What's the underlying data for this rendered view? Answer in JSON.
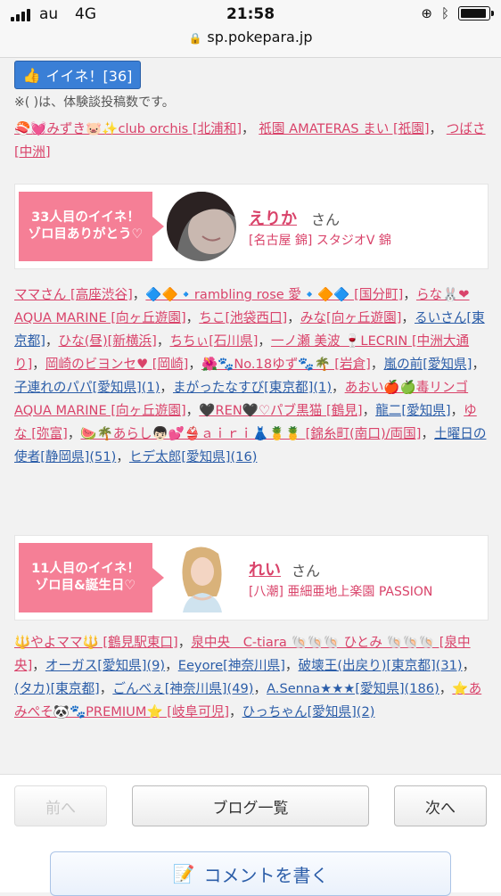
{
  "status_bar": {
    "carrier": "au",
    "network": "4G",
    "time": "21:58",
    "battery_level": 0.95
  },
  "browser": {
    "url": "sp.pokepara.jp"
  },
  "like_button": {
    "label": "イイネ！[36]"
  },
  "note": "※( )は、体験談投稿数です。",
  "section1": {
    "line1": "🍣💓みずき🐷✨club orchis [北浦和]",
    "comma": "，",
    "line2": "祇園 AMATERAS まい [祇園]",
    "line3": "つばさ[中洲]"
  },
  "card1": {
    "ribbon": "33人目のイイネ！\nゾロ目ありがとう♡",
    "name": "えりか",
    "san": "さん",
    "shop": "[名古屋 錦] スタジオV 錦"
  },
  "section2": {
    "items": [
      {
        "text": "ママさん [高座渋谷]",
        "c": "p"
      },
      {
        "text": "🔷🔶🔹rambling rose 愛🔹🔶🔷 [国分町]",
        "c": "p"
      },
      {
        "text": "らな🐰❤ AQUA MARINE [向ヶ丘遊園]",
        "c": "p"
      },
      {
        "text": "ちこ[池袋西口]",
        "c": "p"
      },
      {
        "text": "みな[向ヶ丘遊園]",
        "c": "p"
      },
      {
        "text": "るいさん[東京都]",
        "c": "b"
      },
      {
        "text": "ひな(昼)[新横浜]",
        "c": "p"
      },
      {
        "text": "ちちぃ[石川県]",
        "c": "p"
      },
      {
        "text": "一ノ瀬 美波 🍷LECRIN [中洲大通り]",
        "c": "p"
      },
      {
        "text": "岡崎のビヨンセ♥ [岡崎]",
        "c": "p"
      },
      {
        "text": "🌺🐾No.18ゆず🐾🌴 [岩倉]",
        "c": "p"
      },
      {
        "text": "嵐の前[愛知県]",
        "c": "b"
      },
      {
        "text": "子連れのパパ[愛知県](1)",
        "c": "b"
      },
      {
        "text": "まがったなすび[東京都](1)",
        "c": "b"
      },
      {
        "text": "あおい🍎🍏毒リンゴ AQUA MARINE [向ヶ丘遊園]",
        "c": "p"
      },
      {
        "text": "🖤REN🖤♡パブ黒猫 [鶴見]",
        "c": "p"
      },
      {
        "text": "龍二[愛知県]",
        "c": "b"
      },
      {
        "text": "ゆな [弥富]",
        "c": "p"
      },
      {
        "text": "🍉🌴あらし👦🏻💕👙ａｉｒｉ👗🍍🍍 [錦糸町(南口)/両国]",
        "c": "p"
      },
      {
        "text": "土曜日の使者[静岡県](51)",
        "c": "b"
      },
      {
        "text": "ヒデ太郎[愛知県](16)",
        "c": "b"
      }
    ]
  },
  "card2": {
    "ribbon": "11人目のイイネ！\nゾロ目&誕生日♡",
    "name": "れい",
    "san": "さん",
    "shop": "[八潮] 亜細亜地上楽園 PASSION"
  },
  "section3": {
    "items": [
      {
        "text": "🔱やよママ🔱 [鶴見駅東口]",
        "c": "p"
      },
      {
        "text": "泉中央　C-tiara 🐚🐚🐚 ひとみ 🐚🐚🐚 [泉中央]",
        "c": "p"
      },
      {
        "text": "オーガス[愛知県](9)",
        "c": "b"
      },
      {
        "text": "Eeyore[神奈川県]",
        "c": "b"
      },
      {
        "text": "破壊王(出戻り)[東京都](31)",
        "c": "b"
      },
      {
        "text": "(タカ)[東京都]",
        "c": "b"
      },
      {
        "text": "ごんべぇ[神奈川県](49)",
        "c": "b"
      },
      {
        "text": "A.Senna★★★[愛知県](186)",
        "c": "b"
      },
      {
        "text": "⭐あみぺそ🐼🐾PREMIUM⭐ [岐阜可児]",
        "c": "p"
      },
      {
        "text": "ひっちゃん[愛知県](2)",
        "c": "b"
      }
    ]
  },
  "nav": {
    "prev": "前へ",
    "list": "ブログ一覧",
    "next": "次へ"
  },
  "comment_button": {
    "label": "コメントを書く"
  },
  "colors": {
    "pink": "#d9436a",
    "blue": "#2b5da8",
    "ribbon": "#f57f96",
    "button_blue": "#3a7fd6"
  }
}
